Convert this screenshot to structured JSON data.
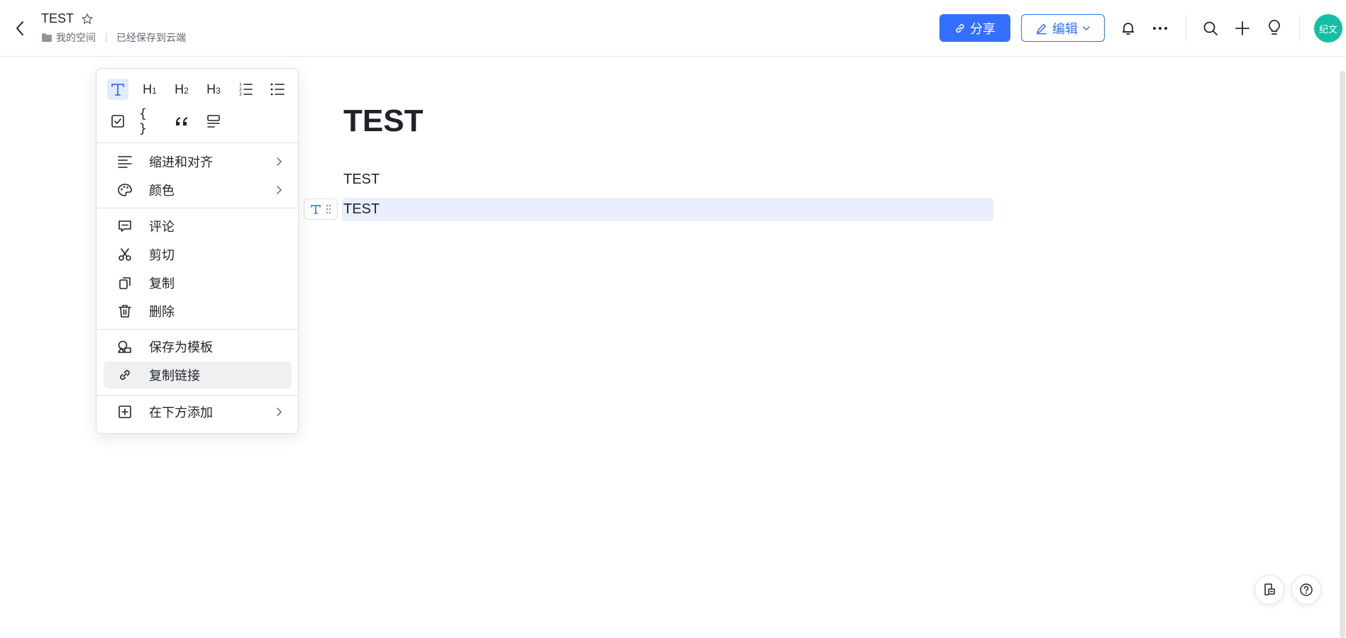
{
  "header": {
    "title": "TEST",
    "breadcrumb_space": "我的空间",
    "save_status": "已经保存到云端",
    "share_label": "分享",
    "edit_label": "编辑",
    "avatar_text": "纪文",
    "accent_color": "#3370ff",
    "avatar_color": "#14c0a5",
    "icons": [
      "back-icon",
      "star-icon",
      "folder-icon",
      "link-icon",
      "pencil-icon",
      "chevron-down-icon",
      "bell-icon",
      "more-icon",
      "search-icon",
      "plus-icon",
      "lightbulb-icon"
    ]
  },
  "document": {
    "heading": "TEST",
    "paragraphs": [
      "TEST",
      "TEST"
    ],
    "selected_block_index": 1,
    "highlight_color": "#e9efff"
  },
  "format_toolbar": {
    "row1": [
      {
        "name": "text",
        "label": "",
        "active": true
      },
      {
        "name": "h1",
        "label": "H",
        "sub": "1"
      },
      {
        "name": "h2",
        "label": "H",
        "sub": "2"
      },
      {
        "name": "h3",
        "label": "H",
        "sub": "3"
      },
      {
        "name": "ordered-list",
        "label": ""
      },
      {
        "name": "bullet-list",
        "label": ""
      }
    ],
    "row2": [
      {
        "name": "todo",
        "label": ""
      },
      {
        "name": "code-block",
        "label": "{ }"
      },
      {
        "name": "quote",
        "label": "“"
      },
      {
        "name": "callout",
        "label": ""
      }
    ]
  },
  "menu": {
    "items": [
      {
        "label": "缩进和对齐",
        "icon": "align-icon",
        "has_submenu": true
      },
      {
        "label": "颜色",
        "icon": "palette-icon",
        "has_submenu": true
      },
      {
        "label": "评论",
        "icon": "comment-icon",
        "has_submenu": false
      },
      {
        "label": "剪切",
        "icon": "scissors-icon",
        "has_submenu": false
      },
      {
        "label": "复制",
        "icon": "copy-icon",
        "has_submenu": false
      },
      {
        "label": "删除",
        "icon": "trash-icon",
        "has_submenu": false
      },
      {
        "label": "保存为模板",
        "icon": "template-icon",
        "has_submenu": false
      },
      {
        "label": "复制链接",
        "icon": "link-icon",
        "has_submenu": false,
        "hovered": true
      },
      {
        "label": "在下方添加",
        "icon": "add-box-icon",
        "has_submenu": true
      }
    ]
  },
  "floating": {
    "icons": [
      "doc-comment-icon",
      "help-icon"
    ]
  }
}
